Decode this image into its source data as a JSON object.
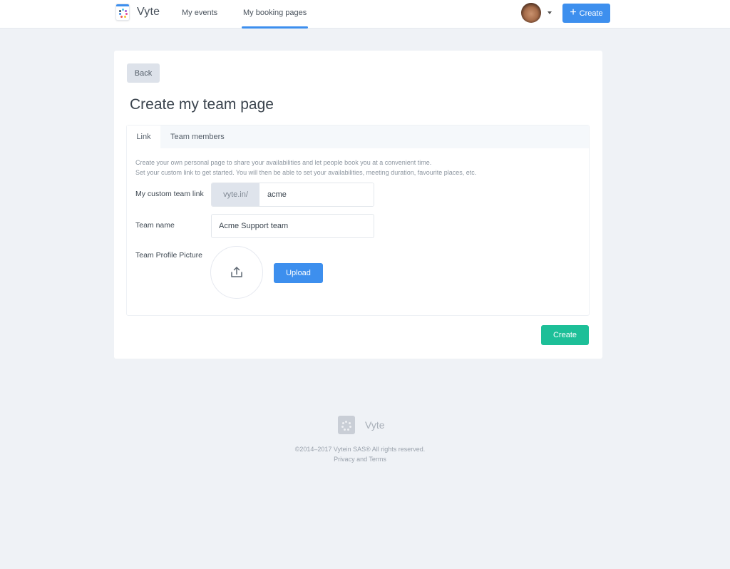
{
  "app": {
    "brand": "Vyte",
    "accent_color": "#3d8fee",
    "success_color": "#1dbf98"
  },
  "nav": {
    "items": [
      {
        "label": "My events",
        "active": false
      },
      {
        "label": "My booking pages",
        "active": true
      }
    ],
    "create_label": "Create",
    "create_icon": "plus-icon",
    "avatar_icon": "user-avatar",
    "menu_icon": "caret-down-icon"
  },
  "page": {
    "back_label": "Back",
    "title": "Create my team page",
    "tabs": [
      {
        "label": "Link",
        "active": true
      },
      {
        "label": "Team members",
        "active": false
      }
    ],
    "description_lines": [
      "Create your own personal page to share your availabilities and let people book you at a convenient time.",
      "Set your custom link to get started. You will then be able to set your availabilities, meeting duration, favourite places, etc."
    ],
    "form": {
      "custom_link_label": "My custom team link",
      "link_prefix": "vyte.in/",
      "link_value": "acme",
      "team_name_label": "Team name",
      "team_name_value": "Acme Support team",
      "picture_label": "Team Profile Picture",
      "picture_icon": "upload-icon",
      "upload_label": "Upload"
    },
    "create_label": "Create"
  },
  "footer": {
    "brand": "Vyte",
    "copyright": "©2014–2017 Vytein SAS® All rights reserved.",
    "terms_link": "Privacy and Terms"
  }
}
